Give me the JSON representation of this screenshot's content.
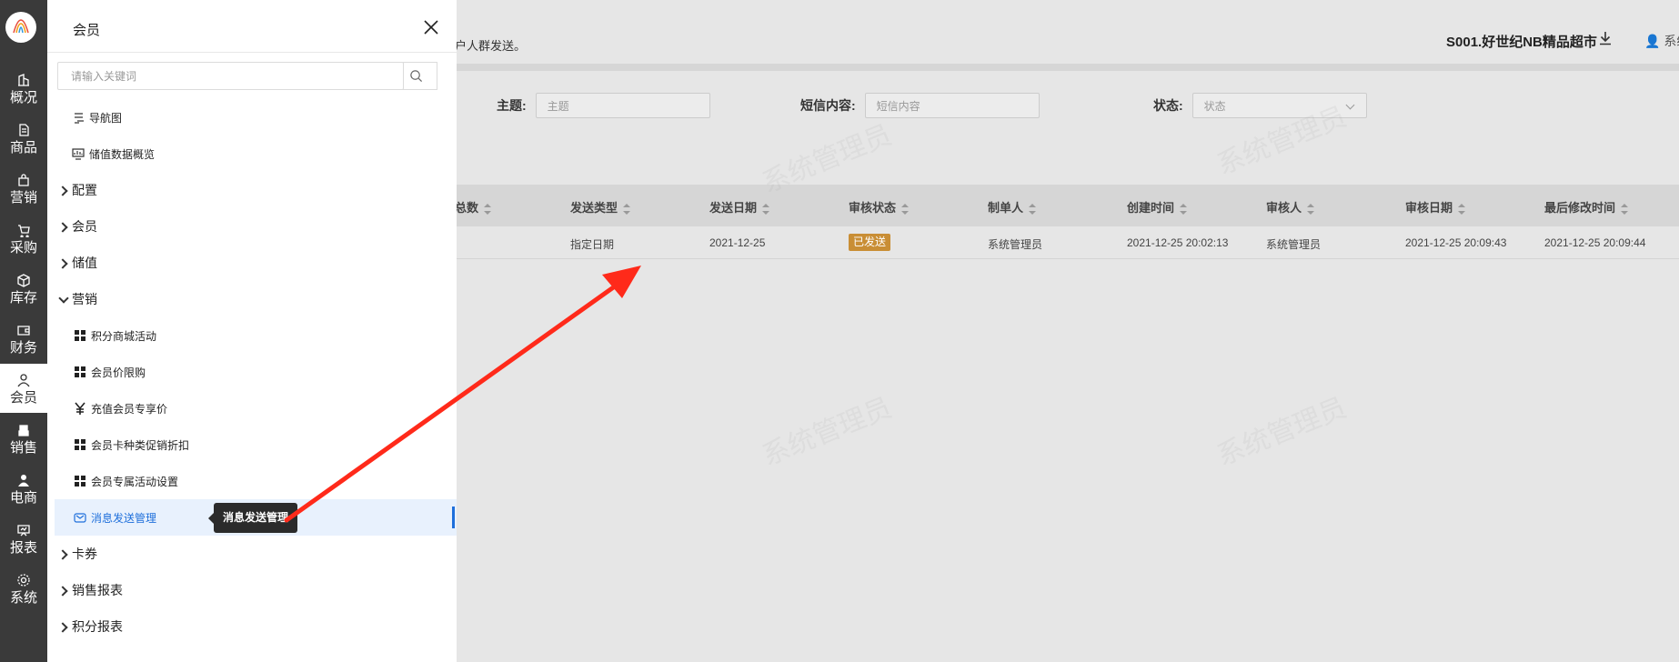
{
  "rail": {
    "items": [
      {
        "label": "概况",
        "icon": "building-icon"
      },
      {
        "label": "商品",
        "icon": "document-icon"
      },
      {
        "label": "营销",
        "icon": "bag-icon"
      },
      {
        "label": "采购",
        "icon": "cart-icon"
      },
      {
        "label": "库存",
        "icon": "box-icon"
      },
      {
        "label": "财务",
        "icon": "wallet-icon"
      },
      {
        "label": "会员",
        "icon": "user-icon"
      },
      {
        "label": "销售",
        "icon": "register-icon"
      },
      {
        "label": "电商",
        "icon": "person-icon"
      },
      {
        "label": "报表",
        "icon": "chart-icon"
      },
      {
        "label": "系统",
        "icon": "gear-icon"
      }
    ],
    "active_index": 6
  },
  "header": {
    "hint_text": "户人群发送。",
    "store_name": "S001.好世纪NB精品超市",
    "user_text": "系统"
  },
  "filters": {
    "subject_label": "主题:",
    "subject_placeholder": "主题",
    "sms_label": "短信内容:",
    "sms_placeholder": "短信内容",
    "status_label": "状态:",
    "status_placeholder": "状态"
  },
  "table": {
    "columns": [
      "总数",
      "发送类型",
      "发送日期",
      "审核状态",
      "制单人",
      "创建时间",
      "审核人",
      "审核日期",
      "最后修改时间"
    ],
    "row": {
      "send_type": "指定日期",
      "send_date": "2021-12-25",
      "status": "已发送",
      "creator": "系统管理员",
      "created_at": "2021-12-25 20:02:13",
      "reviewer": "系统管理员",
      "review_date": "2021-12-25 20:09:43",
      "modified_at": "2021-12-25 20:09:44"
    }
  },
  "watermark": "系统管理员",
  "drawer": {
    "title": "会员",
    "search_placeholder": "请输入关键词",
    "items": [
      {
        "type": "sub",
        "label": "导航图",
        "icon": "navigation-icon"
      },
      {
        "type": "sub",
        "label": "储值数据概览",
        "icon": "dashboard-icon"
      },
      {
        "type": "group",
        "label": "配置",
        "open": false
      },
      {
        "type": "group",
        "label": "会员",
        "open": false
      },
      {
        "type": "group",
        "label": "储值",
        "open": false
      },
      {
        "type": "group",
        "label": "营销",
        "open": true
      },
      {
        "type": "sub2",
        "label": "积分商城活动",
        "icon": "grid-icon"
      },
      {
        "type": "sub2",
        "label": "会员价限购",
        "icon": "grid-icon"
      },
      {
        "type": "sub2",
        "label": "充值会员专享价",
        "icon": "yen-icon"
      },
      {
        "type": "sub2",
        "label": "会员卡种类促销折扣",
        "icon": "grid-icon"
      },
      {
        "type": "sub2",
        "label": "会员专属活动设置",
        "icon": "grid-icon"
      },
      {
        "type": "sub2",
        "label": "消息发送管理",
        "icon": "message-icon",
        "selected": true
      },
      {
        "type": "group",
        "label": "卡券",
        "open": false
      },
      {
        "type": "group",
        "label": "销售报表",
        "open": false
      },
      {
        "type": "group",
        "label": "积分报表",
        "open": false
      }
    ],
    "tooltip": "消息发送管理"
  },
  "colors": {
    "accent": "#1e6fdb",
    "arrow": "#ff2a1a",
    "badge": "#c98e35",
    "rail": "#3a3a3a"
  }
}
